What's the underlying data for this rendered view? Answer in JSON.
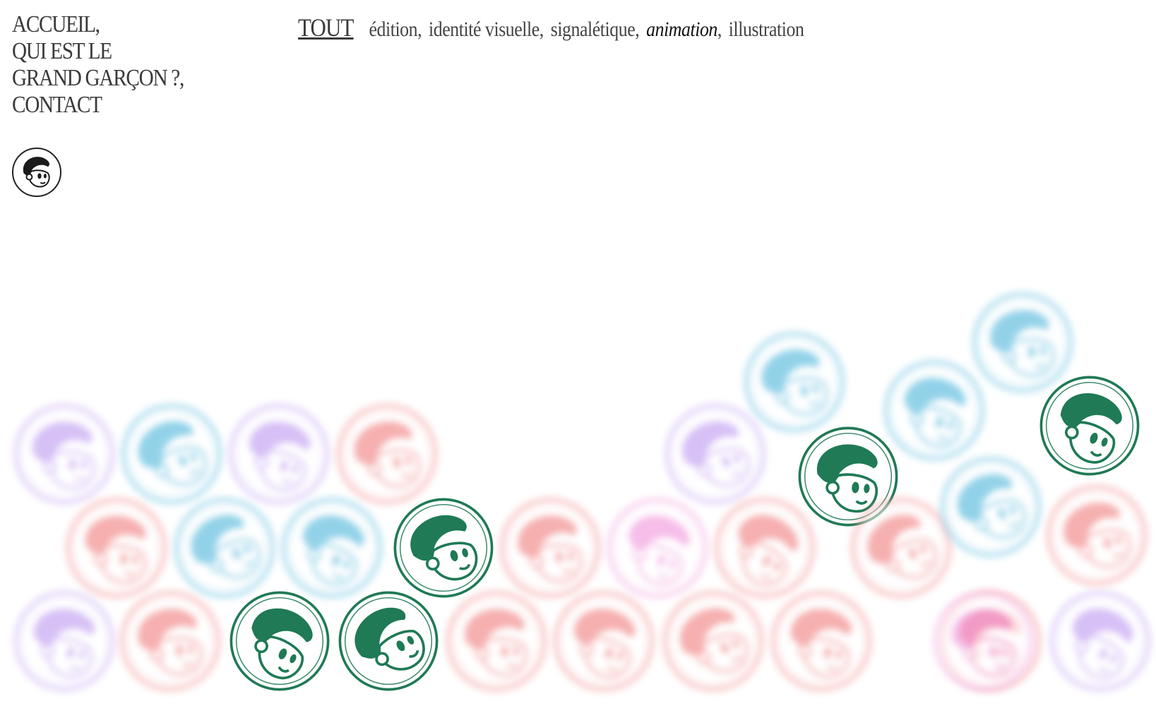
{
  "nav": {
    "items": [
      {
        "label": "ACCUEIL,"
      },
      {
        "label": "QUI EST LE"
      },
      {
        "label": "GRAND GARÇON ?,"
      },
      {
        "label": "CONTACT"
      }
    ],
    "logo_icon": "boy-face-icon"
  },
  "filters": {
    "all_label": "TOUT",
    "categories": [
      {
        "label": "édition",
        "sep": ","
      },
      {
        "label": "identité visuelle",
        "sep": ","
      },
      {
        "label": "signalétique",
        "sep": ","
      },
      {
        "label": "animation",
        "sep": ",",
        "active": true
      },
      {
        "label": "illustration",
        "sep": ""
      }
    ]
  },
  "colors": {
    "green": "#1f7a55",
    "blue": "#3aaed8",
    "red": "#f07070",
    "pink": "#f08ad8",
    "purple": "#b78ef0"
  },
  "bubbles": [
    {
      "color": "purple",
      "active": false
    },
    {
      "color": "blue",
      "active": false
    },
    {
      "color": "purple",
      "active": false
    },
    {
      "color": "red",
      "active": false
    },
    {
      "color": "red",
      "active": false
    },
    {
      "color": "blue",
      "active": false
    },
    {
      "color": "blue",
      "active": false
    },
    {
      "color": "green",
      "active": true
    },
    {
      "color": "purple",
      "active": false
    },
    {
      "color": "red",
      "active": false
    },
    {
      "color": "green",
      "active": true
    },
    {
      "color": "green",
      "active": true
    },
    {
      "color": "red",
      "active": false
    },
    {
      "color": "red",
      "active": false
    },
    {
      "color": "red",
      "active": false
    },
    {
      "color": "red",
      "active": false
    },
    {
      "color": "red",
      "active": false
    },
    {
      "color": "pink",
      "active": false
    },
    {
      "color": "purple",
      "active": false
    },
    {
      "color": "red",
      "active": false
    },
    {
      "color": "blue",
      "active": false
    },
    {
      "color": "green",
      "active": true
    },
    {
      "color": "red",
      "active": false
    },
    {
      "color": "blue",
      "active": false
    },
    {
      "color": "blue",
      "active": false
    },
    {
      "color": "red",
      "active": false
    },
    {
      "color": "blue",
      "active": false
    },
    {
      "color": "green",
      "active": true
    },
    {
      "color": "red",
      "active": false
    },
    {
      "color": "pink",
      "active": false
    },
    {
      "color": "purple",
      "active": false
    }
  ]
}
